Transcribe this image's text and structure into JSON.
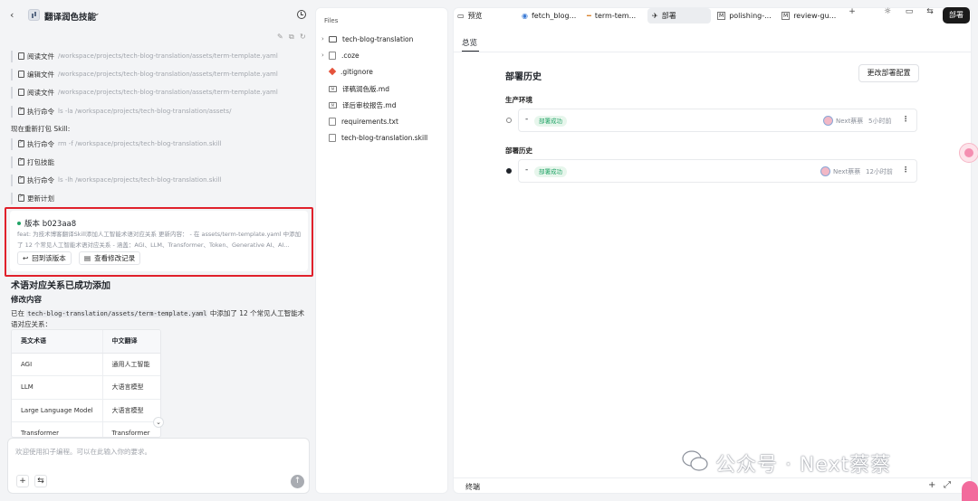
{
  "left": {
    "title": "翻译润色技能",
    "back_icon": "‹",
    "steps_top": [
      {
        "label": "阅读文件",
        "arg": "/workspace/projects/tech-blog-translation/assets/term-template.yaml",
        "icon": "file"
      },
      {
        "label": "编辑文件",
        "arg": "/workspace/projects/tech-blog-translation/assets/term-template.yaml",
        "icon": "file"
      },
      {
        "label": "阅读文件",
        "arg": "/workspace/projects/tech-blog-translation/assets/term-template.yaml",
        "icon": "file"
      },
      {
        "label": "执行命令",
        "arg": "ls -la /workspace/projects/tech-blog-translation/assets/",
        "icon": "term"
      }
    ],
    "repack_text": "现在重新打包 Skill:",
    "steps_bottom": [
      {
        "label": "执行命令",
        "arg": "rm -f /workspace/projects/tech-blog-translation.skill",
        "icon": "term"
      },
      {
        "label": "打包技能",
        "arg": "",
        "icon": "term"
      },
      {
        "label": "执行命令",
        "arg": "ls -lh /workspace/projects/tech-blog-translation.skill",
        "icon": "term"
      },
      {
        "label": "更新计划",
        "arg": "",
        "icon": "term"
      }
    ],
    "version": {
      "title": "版本 b023aa8",
      "desc": "feat: 为技术博客翻译Skill添加人工智能术语对应关系 更新内容： - 在 assets/term-template.yaml 中添加了 12 个常见人工智能术语对应关系 - 涵盖：AGI、LLM、Transformer、Token、Generative AI、AI...",
      "restore_label": "回到该版本",
      "history_label": "查看修改记录"
    },
    "success_title": "术语对应关系已成功添加",
    "changes_title": "修改内容",
    "para_before": "已在 ",
    "para_code": "tech-blog-translation/assets/term-template.yaml",
    "para_after": " 中添加了 12 个常见人工智能术语对应关系：",
    "table": {
      "headers": [
        "英文术语",
        "中文翻译"
      ],
      "rows": [
        [
          "AGI",
          "通用人工智能"
        ],
        [
          "LLM",
          "大语言模型"
        ],
        [
          "Large Language Model",
          "大语言模型"
        ],
        [
          "Transformer",
          "Transformer"
        ]
      ]
    },
    "input_placeholder": "欢迎使用扣子编程。可以在此输入你的要求。"
  },
  "files": {
    "header": "Files",
    "items": [
      {
        "name": "tech-blog-translation",
        "type": "folder",
        "expand": "›"
      },
      {
        "name": ".coze",
        "type": "file",
        "expand": "›"
      },
      {
        "name": ".gitignore",
        "type": "git",
        "expand": ""
      },
      {
        "name": "译稿润色版.md",
        "type": "md",
        "expand": ""
      },
      {
        "name": "译后审校报告.md",
        "type": "md",
        "expand": ""
      },
      {
        "name": "requirements.txt",
        "type": "file",
        "expand": ""
      },
      {
        "name": "tech-blog-translation.skill",
        "type": "file",
        "expand": ""
      }
    ]
  },
  "tabs": [
    {
      "label": "预览",
      "icon": "▭",
      "active": false
    },
    {
      "label": "fetch_blog...",
      "icon": "◉",
      "active": false
    },
    {
      "label": "term-tem...",
      "icon": "━",
      "active": false
    },
    {
      "label": "部署",
      "icon": "✈",
      "active": true
    },
    {
      "label": "polishing-...",
      "icon": "M",
      "active": false
    },
    {
      "label": "review-gu...",
      "icon": "M",
      "active": false
    }
  ],
  "deploy_button": "部署",
  "overview": {
    "tab": "总览",
    "history_title": "部署历史",
    "change_config": "更改部署配置",
    "prod_label": "生产环境",
    "history_label": "部署历史",
    "records": [
      {
        "status": "部署成功",
        "user": "Next蔡蔡",
        "time": "5小时前",
        "dash": "-"
      },
      {
        "status": "部署成功",
        "user": "Next蔡蔡",
        "time": "12小时前",
        "dash": "-"
      }
    ]
  },
  "terminal_label": "终端",
  "watermark": "公众号 · Next蔡蔡",
  "colors": {
    "accent_green": "#21a366",
    "highlight_red": "#e0202b",
    "dark_button": "#1a1a1a"
  }
}
